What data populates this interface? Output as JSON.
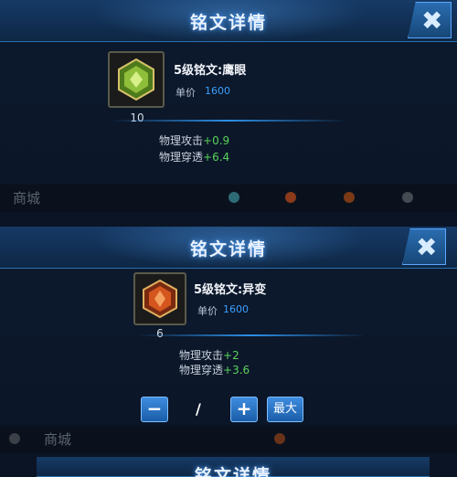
{
  "panel1": {
    "title": "铭文详情",
    "close_glyph": "✖",
    "icon": "rune-green-gem-icon",
    "count": "10",
    "name": "5级铭文:鹰眼",
    "price_label": "单价",
    "price_value": "1600",
    "stats": [
      {
        "label": "物理攻击",
        "value": "+0.9"
      },
      {
        "label": "物理穿透",
        "value": "+6.4"
      }
    ]
  },
  "bg_strip1": {
    "shop_label": "商城"
  },
  "panel2": {
    "title": "铭文详情",
    "close_glyph": "✖",
    "icon": "rune-red-gem-icon",
    "count": "6",
    "name": "5级铭文:异变",
    "price_label": "单价",
    "price_value": "1600",
    "stats": [
      {
        "label": "物理攻击",
        "value": "+2"
      },
      {
        "label": "物理穿透",
        "value": "+3.6"
      }
    ],
    "controls": {
      "minus": "−",
      "quantity": "/",
      "plus": "+",
      "max": "最大"
    }
  },
  "bg_strip2": {
    "shop_label": "商城"
  },
  "panel3": {
    "title": "铭文详情"
  },
  "colors": {
    "accent": "#3aa0ff",
    "stat_green": "#59d35a",
    "header_blue": "#163a66"
  }
}
